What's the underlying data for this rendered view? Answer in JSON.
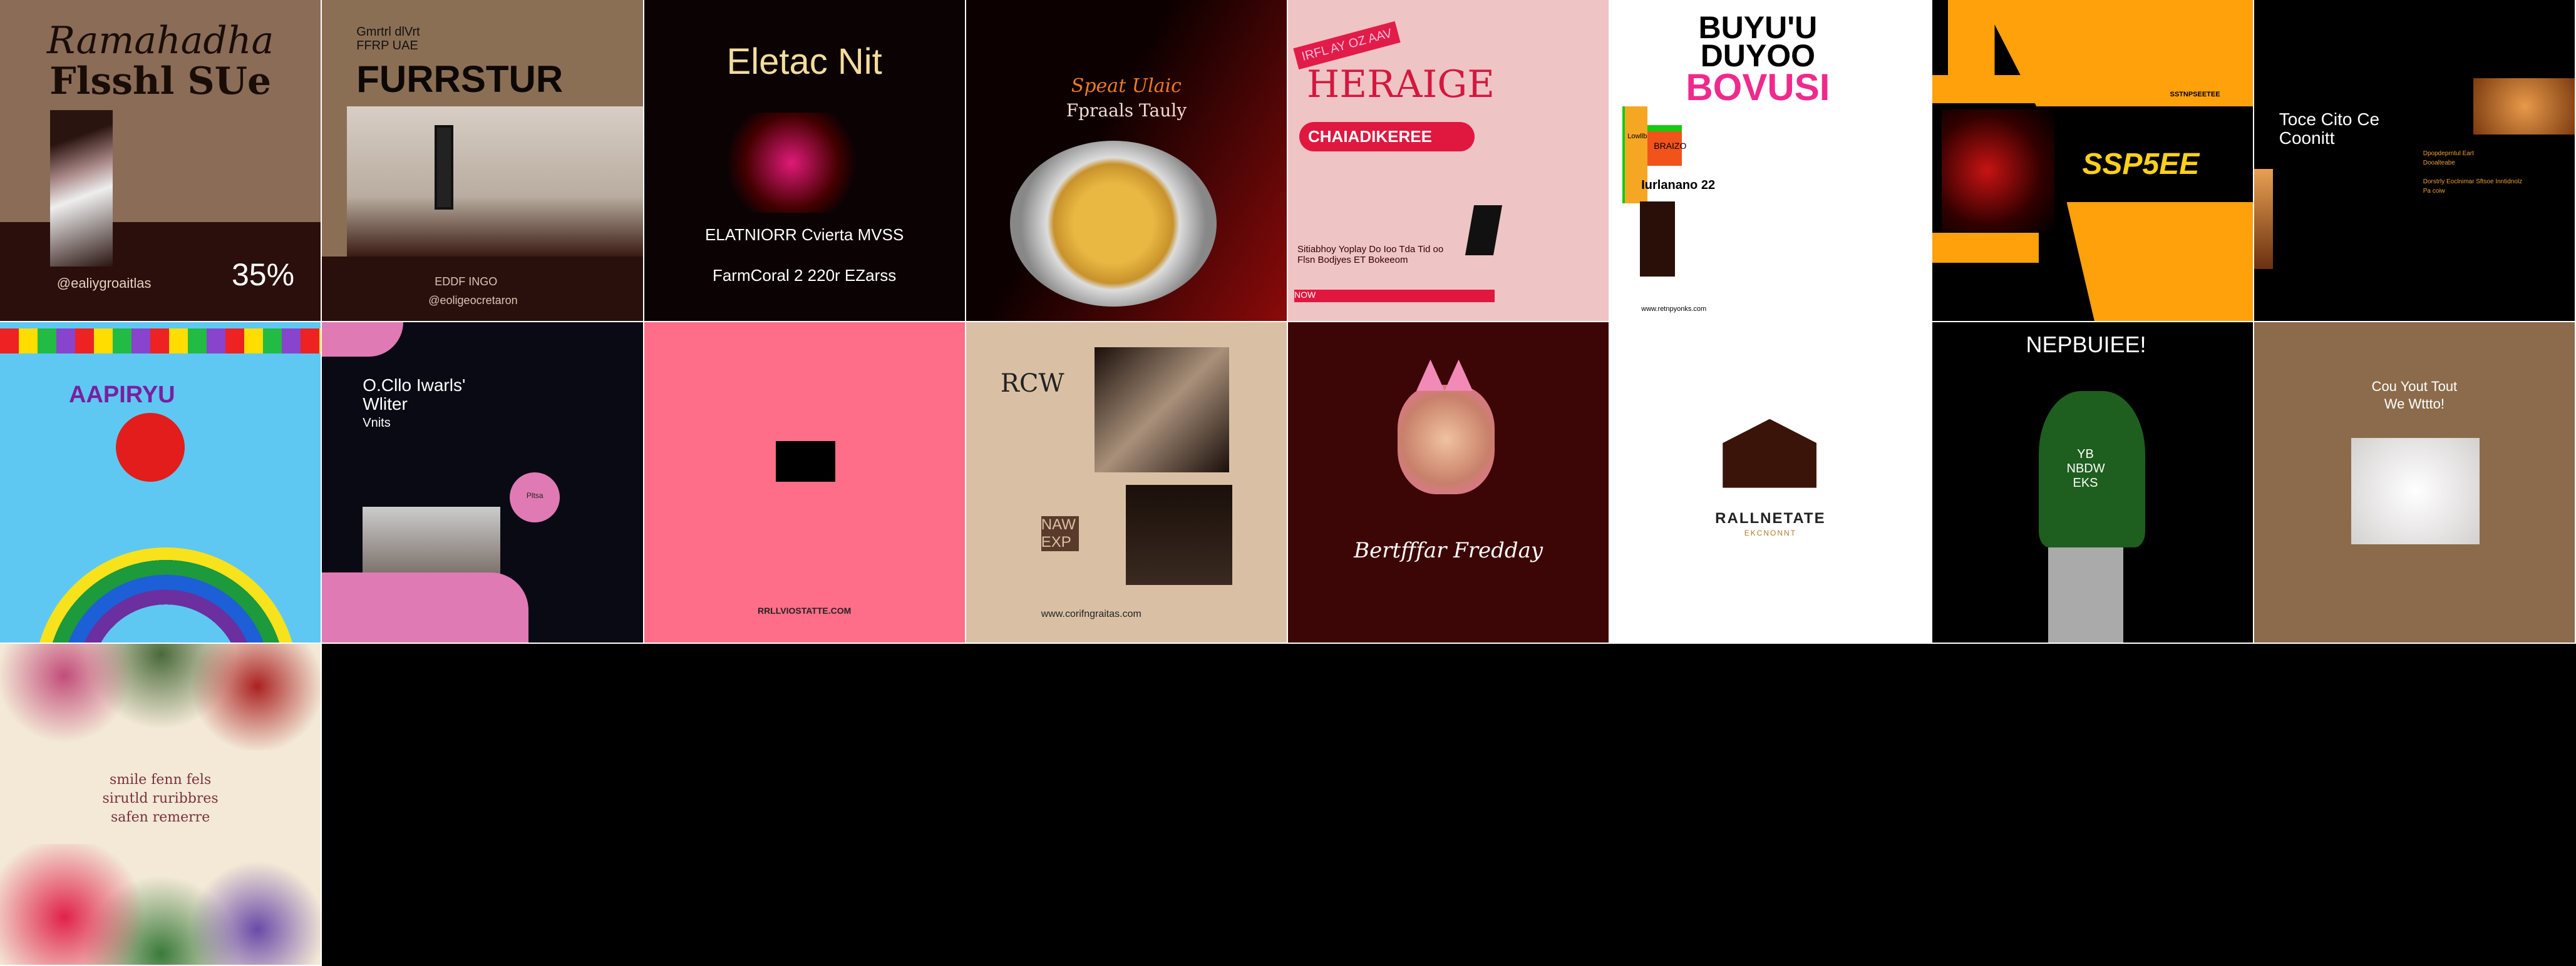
{
  "tiles": [
    {
      "title": "Ramahadha",
      "subtitle": "Flsshl SUe",
      "handle": "@ealiygroaitlas",
      "badge": "35%"
    },
    {
      "top1": "Gmrtrl dlVrt",
      "top2": "FFRP UAE",
      "title": "FURRSTUR",
      "tag": "EDDF INGO",
      "handle": "@eoligeocretaron"
    },
    {
      "title": "Eletac Nit",
      "line1": "ELATNIORR Cvierta MVSS",
      "line2": "FarmCoral 2 220r EZarss"
    },
    {
      "script": "Speat Ulaic",
      "subtitle": "Fpraals Tauly"
    },
    {
      "ribbon": "IRFL AY OZ AAV",
      "title": "HERAIGE",
      "banner": "CHAIADIKEREE",
      "body": "Sitiabhoy Yoplay Do Ioo Tda Tid oo Flsn Bodjyes ET Bokeeom",
      "footer": "NOW"
    },
    {
      "title1": "BUYU'U",
      "title2": "DUYOO",
      "title3": "BOVUSI",
      "box": "BRAIZO",
      "label": "Lowllbeiry",
      "subhead": "Iurlanano 22",
      "footer": "www.retnpyonks.com"
    },
    {
      "small": "SSTNPSEETEE",
      "title": "SSP5EE"
    },
    {
      "title1": "Toce Cito Ce",
      "title2": "Coonitt",
      "line1": "Dpopdeprntul Eart",
      "line2": "Dooalteabe",
      "line3": "Dorstrly Eoclnimar Sftsoe Inntidnolz",
      "line4": "Pa coiw"
    },
    {
      "title": "AAPIRYU"
    },
    {
      "title1": "O.Cllo Iwarls'",
      "title2": "Wliter",
      "title3": "Vnits",
      "badge": "Pltsa"
    },
    {
      "footer": "RRLLVIOSTATTE.COM"
    },
    {
      "title": "RCW",
      "sub": "NAW EXP",
      "footer": "www.corifngraitas.com"
    },
    {
      "script": "Bertfffar Fredday"
    },
    {
      "brand": "RALLNETATE",
      "sub": "EKCNONNT"
    },
    {
      "title": "NEPBUIEE!",
      "chest": "YB NBDW EKS"
    },
    {
      "title1": "Cou Yout Tout",
      "title2": "We Wttto!"
    },
    {
      "line1": "smile fenn fels",
      "line2": "sirutld ruribbres",
      "line3": "safen remerre"
    }
  ]
}
